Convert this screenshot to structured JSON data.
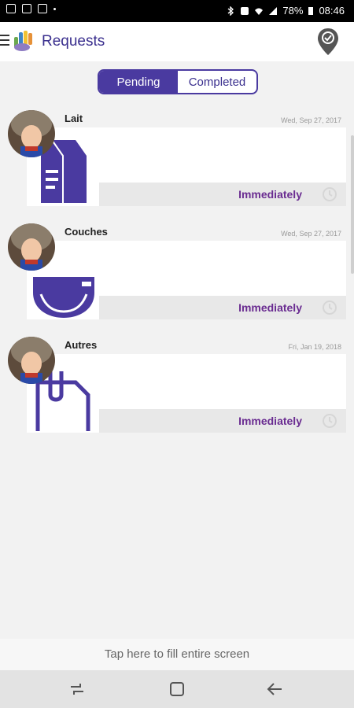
{
  "status_bar": {
    "battery": "78%",
    "time": "08:46"
  },
  "header": {
    "title": "Requests",
    "menu_icon": "hamburger-icon",
    "logo_icon": "hand-logo-icon",
    "location_icon": "location-pin-check-icon"
  },
  "tabs": [
    {
      "label": "Pending",
      "active": true
    },
    {
      "label": "Completed",
      "active": false
    }
  ],
  "requests": [
    {
      "title": "Lait",
      "date": "Wed, Sep 27, 2017",
      "timing": "Immediately",
      "icon": "milk-carton-icon"
    },
    {
      "title": "Couches",
      "date": "Wed, Sep 27, 2017",
      "timing": "Immediately",
      "icon": "diaper-icon"
    },
    {
      "title": "Autres",
      "date": "Fri, Jan 19, 2018",
      "timing": "Immediately",
      "icon": "paperclip-document-icon"
    }
  ],
  "fill_screen_text": "Tap here to fill entire screen",
  "colors": {
    "accent": "#4a3aa0",
    "timing_text": "#6a2c91"
  }
}
